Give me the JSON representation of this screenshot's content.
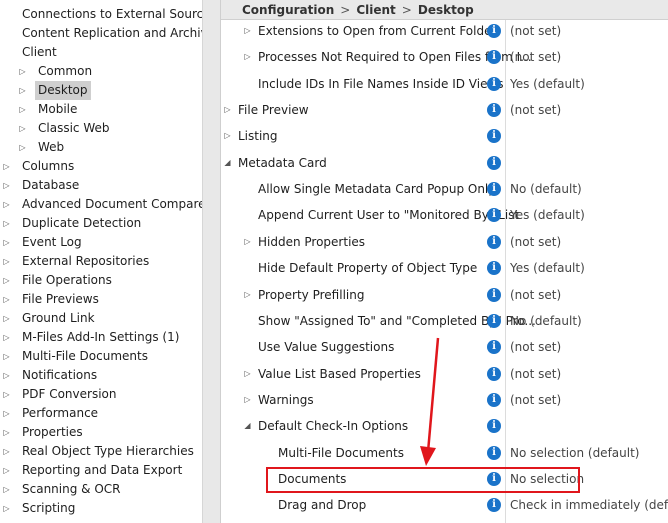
{
  "tree": [
    {
      "label": "Connections to External Sources",
      "level": 0,
      "arrow": ""
    },
    {
      "label": "Content Replication and Archiving",
      "level": 0,
      "arrow": ""
    },
    {
      "label": "Client",
      "level": 0,
      "arrow": ""
    },
    {
      "label": "Common",
      "level": 1,
      "arrow": "▷"
    },
    {
      "label": "Desktop",
      "level": 1,
      "arrow": "▷",
      "selected": true
    },
    {
      "label": "Mobile",
      "level": 1,
      "arrow": "▷"
    },
    {
      "label": "Classic Web",
      "level": 1,
      "arrow": "▷"
    },
    {
      "label": "Web",
      "level": 1,
      "arrow": "▷"
    },
    {
      "label": "Columns",
      "level": 0,
      "arrow": "▷"
    },
    {
      "label": "Database",
      "level": 0,
      "arrow": "▷"
    },
    {
      "label": "Advanced Document Compare",
      "level": 0,
      "arrow": "▷"
    },
    {
      "label": "Duplicate Detection",
      "level": 0,
      "arrow": "▷"
    },
    {
      "label": "Event Log",
      "level": 0,
      "arrow": "▷"
    },
    {
      "label": "External Repositories",
      "level": 0,
      "arrow": "▷"
    },
    {
      "label": "File Operations",
      "level": 0,
      "arrow": "▷"
    },
    {
      "label": "File Previews",
      "level": 0,
      "arrow": "▷"
    },
    {
      "label": "Ground Link",
      "level": 0,
      "arrow": "▷"
    },
    {
      "label": "M-Files Add-In Settings (1)",
      "level": 0,
      "arrow": "▷"
    },
    {
      "label": "Multi-File Documents",
      "level": 0,
      "arrow": "▷"
    },
    {
      "label": "Notifications",
      "level": 0,
      "arrow": "▷"
    },
    {
      "label": "PDF Conversion",
      "level": 0,
      "arrow": "▷"
    },
    {
      "label": "Performance",
      "level": 0,
      "arrow": "▷"
    },
    {
      "label": "Properties",
      "level": 0,
      "arrow": "▷"
    },
    {
      "label": "Real Object Type Hierarchies",
      "level": 0,
      "arrow": "▷"
    },
    {
      "label": "Reporting and Data Export",
      "level": 0,
      "arrow": "▷"
    },
    {
      "label": "Scanning & OCR",
      "level": 0,
      "arrow": "▷"
    },
    {
      "label": "Scripting",
      "level": 0,
      "arrow": "▷"
    }
  ],
  "breadcrumb": {
    "part1": "Configuration",
    "part2": "Client",
    "part3": "Desktop",
    "separator": ">"
  },
  "info_icon": "i",
  "settings": [
    {
      "label": "Extensions to Open from Current Folder",
      "level": 1,
      "arrow": "▷",
      "value": "(not set)"
    },
    {
      "label": "Processes Not Required to Open Files from I...",
      "level": 1,
      "arrow": "▷",
      "value": "(not set)"
    },
    {
      "label": "Include IDs In File Names Inside ID Views",
      "level": 1,
      "arrow": "",
      "value": "Yes (default)"
    },
    {
      "label": "File Preview",
      "level": 0,
      "arrow": "▷",
      "value": "(not set)"
    },
    {
      "label": "Listing",
      "level": 0,
      "arrow": "▷",
      "value": ""
    },
    {
      "label": "Metadata Card",
      "level": 0,
      "arrow": "◢",
      "value": ""
    },
    {
      "label": "Allow Single Metadata Card Popup Only",
      "level": 1,
      "arrow": "",
      "value": "No (default)"
    },
    {
      "label": "Append Current User to \"Monitored By\" List",
      "level": 1,
      "arrow": "",
      "value": "Yes (default)"
    },
    {
      "label": "Hidden Properties",
      "level": 1,
      "arrow": "▷",
      "value": "(not set)"
    },
    {
      "label": "Hide Default Property of Object Type",
      "level": 1,
      "arrow": "",
      "value": "Yes (default)"
    },
    {
      "label": "Property Prefilling",
      "level": 1,
      "arrow": "▷",
      "value": "(not set)"
    },
    {
      "label": "Show \"Assigned To\" and \"Completed By\" Pro...",
      "level": 1,
      "arrow": "",
      "value": "No (default)"
    },
    {
      "label": "Use Value Suggestions",
      "level": 1,
      "arrow": "",
      "value": "(not set)"
    },
    {
      "label": "Value List Based Properties",
      "level": 1,
      "arrow": "▷",
      "value": "(not set)"
    },
    {
      "label": "Warnings",
      "level": 1,
      "arrow": "▷",
      "value": "(not set)"
    },
    {
      "label": "Default Check-In Options",
      "level": 1,
      "arrow": "◢",
      "value": ""
    },
    {
      "label": "Multi-File Documents",
      "level": 2,
      "arrow": "",
      "value": "No selection (default)"
    },
    {
      "label": "Documents",
      "level": 2,
      "arrow": "",
      "value": "No selection"
    },
    {
      "label": "Drag and Drop",
      "level": 2,
      "arrow": "",
      "value": "Check in immediately (default)"
    }
  ],
  "colors": {
    "accent_info": "#1a73c9",
    "highlight": "#e0161c",
    "selected_bg": "#cfcfcf"
  }
}
